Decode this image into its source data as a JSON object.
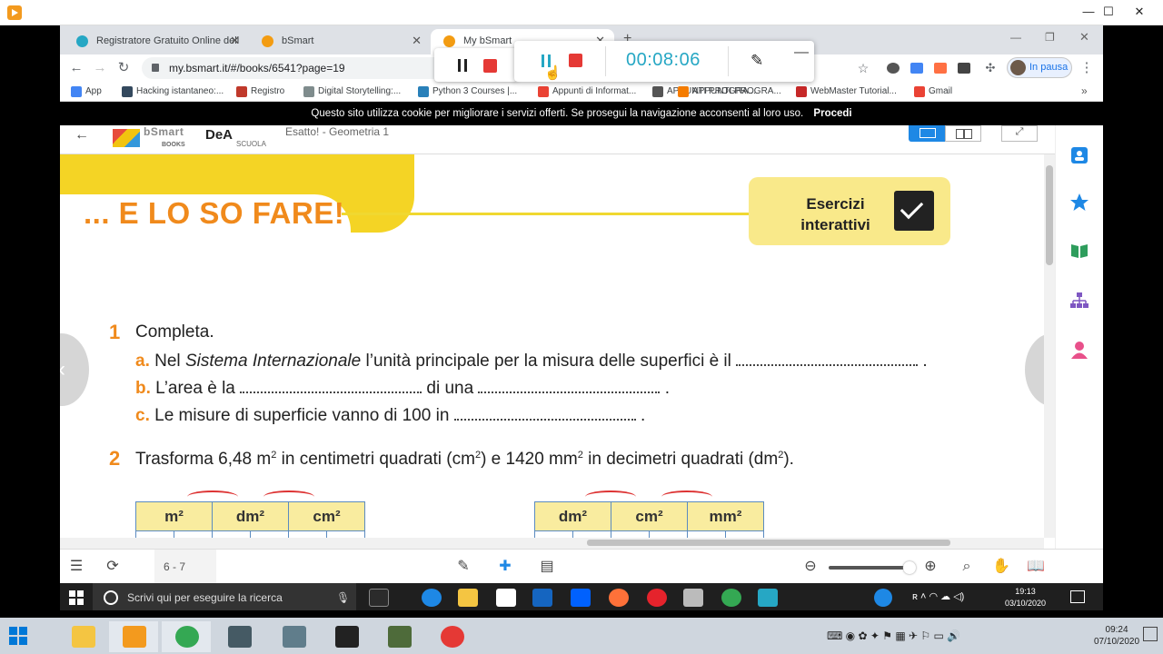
{
  "outer_window": {
    "minimize": "—",
    "maximize": "☐",
    "close": "✕"
  },
  "browser": {
    "tabs": [
      {
        "title": "Registratore Gratuito Online dell",
        "active": false
      },
      {
        "title": "bSmart",
        "active": false
      },
      {
        "title": "My bSmart",
        "active": true
      }
    ],
    "new_tab": "+",
    "url": "my.bsmart.it/#/books/6541?page=19",
    "profile_label": "In pausa",
    "bookmarks": [
      {
        "label": "App",
        "color": "#4285f4"
      },
      {
        "label": "Hacking istantaneo:...",
        "color": "#34495e"
      },
      {
        "label": "Registro",
        "color": "#c0392b"
      },
      {
        "label": "Digital Storytelling:...",
        "color": "#7f8c8d"
      },
      {
        "label": "Python 3 Courses |...",
        "color": "#2980b9"
      },
      {
        "label": "Appunti di Informat...",
        "color": "#ea4335"
      },
      {
        "label": "APPUNTI PROGRA...",
        "color": "#555555"
      },
      {
        "label": "APPUNTI PROGRA...",
        "color": "#f57c00"
      },
      {
        "label": "WebMaster Tutorial...",
        "color": "#c62828"
      },
      {
        "label": "Gmail",
        "color": "#ea4335"
      }
    ],
    "bookmarks_more": "»"
  },
  "cookie_bar": {
    "text": "Questo sito utilizza cookie per migliorare i servizi offerti. Se prosegui la navigazione acconsenti al loro uso.",
    "accept": "Procedi"
  },
  "app_header": {
    "back": "←",
    "bsmart_name": "bSmart",
    "bsmart_sub": "BOOKS",
    "dea_name": "DeA",
    "dea_sub": "SCUOLA",
    "book_title": "Esatto! - Geometria 1",
    "fullscreen": "⤢"
  },
  "page": {
    "banner_title": "... E LO SO FARE!",
    "exercise_box": "Esercizi interattivi",
    "ex1": {
      "number": "1",
      "title": "Completa.",
      "a_letter": "a.",
      "a_text_1": "Nel",
      "a_text_italic": "Sistema Internazionale",
      "a_text_2": "l’unità principale per la misura delle superfici è il",
      "b_letter": "b.",
      "b_text_1": "L’area è la",
      "b_text_2": "di una",
      "c_letter": "c.",
      "c_text": "Le misure di superficie vanno di 100 in",
      "period": "."
    },
    "ex2": {
      "number": "2",
      "text_1": "Trasforma 6,48 m",
      "text_2": " in centimetri quadrati (cm",
      "text_3": ") e 1420 mm",
      "text_4": " in decimetri quadrati (dm",
      "text_5": ").",
      "sup": "2",
      "table_left": [
        "m²",
        "dm²",
        "cm²"
      ],
      "table_right": [
        "dm²",
        "cm²",
        "mm²"
      ]
    },
    "prev": "‹",
    "next": "›"
  },
  "bottom_bar": {
    "page_indicator": "6 - 7"
  },
  "inner_taskbar": {
    "search_placeholder": "Scrivi qui per eseguire la ricerca",
    "time": "19:13",
    "date": "03/10/2020"
  },
  "recorder": {
    "timer": "00:08:06",
    "minimize": "—"
  },
  "outer_taskbar": {
    "time": "09:24",
    "date": "07/10/2020"
  },
  "colors": {
    "accent_orange": "#f08a1c",
    "banner_yellow": "#f4d425",
    "timer_blue": "#26a7c4",
    "stop_red": "#e53935"
  }
}
